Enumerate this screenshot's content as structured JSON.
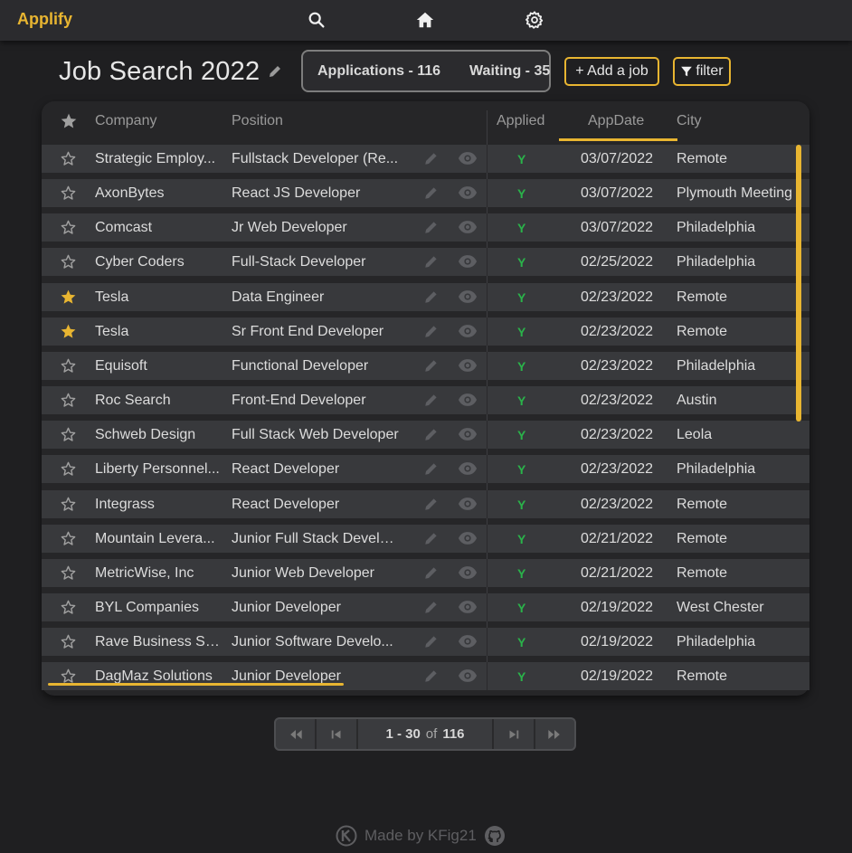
{
  "app": {
    "brand": "Applify"
  },
  "nav": {
    "icons": [
      "search-icon",
      "home-icon",
      "gear-icon"
    ]
  },
  "page": {
    "title": "Job Search 2022"
  },
  "stats": {
    "applications": "Applications - 116",
    "waiting": "Waiting - 35"
  },
  "actions": {
    "add_job": "+ Add a job",
    "filter": "filter"
  },
  "colors": {
    "accent": "#e8b531",
    "applied": "#2ab34a",
    "background": "#1f1f21",
    "row": "#38393c"
  },
  "table": {
    "columns": {
      "company": "Company",
      "position": "Position",
      "applied": "Applied",
      "appdate": "AppDate",
      "city": "City"
    },
    "sorted_column": "AppDate",
    "rows": [
      {
        "starred": false,
        "company": "Strategic Employ...",
        "position": "Fullstack Developer (Re...",
        "applied": "Y",
        "date": "03/07/2022",
        "city": "Remote"
      },
      {
        "starred": false,
        "company": "AxonBytes",
        "position": "React JS Developer",
        "applied": "Y",
        "date": "03/07/2022",
        "city": "Plymouth Meeting"
      },
      {
        "starred": false,
        "company": "Comcast",
        "position": "Jr Web Developer",
        "applied": "Y",
        "date": "03/07/2022",
        "city": "Philadelphia"
      },
      {
        "starred": false,
        "company": "Cyber Coders",
        "position": "Full-Stack Developer",
        "applied": "Y",
        "date": "02/25/2022",
        "city": "Philadelphia"
      },
      {
        "starred": true,
        "company": "Tesla",
        "position": "Data Engineer",
        "applied": "Y",
        "date": "02/23/2022",
        "city": "Remote"
      },
      {
        "starred": true,
        "company": "Tesla",
        "position": "Sr Front End Developer",
        "applied": "Y",
        "date": "02/23/2022",
        "city": "Remote"
      },
      {
        "starred": false,
        "company": "Equisoft",
        "position": "Functional Developer",
        "applied": "Y",
        "date": "02/23/2022",
        "city": "Philadelphia"
      },
      {
        "starred": false,
        "company": "Roc Search",
        "position": "Front-End Developer",
        "applied": "Y",
        "date": "02/23/2022",
        "city": "Austin"
      },
      {
        "starred": false,
        "company": "Schweb Design",
        "position": "Full Stack Web Developer",
        "applied": "Y",
        "date": "02/23/2022",
        "city": "Leola"
      },
      {
        "starred": false,
        "company": "Liberty Personnel...",
        "position": "React Developer",
        "applied": "Y",
        "date": "02/23/2022",
        "city": "Philadelphia"
      },
      {
        "starred": false,
        "company": "Integrass",
        "position": "React Developer",
        "applied": "Y",
        "date": "02/23/2022",
        "city": "Remote"
      },
      {
        "starred": false,
        "company": "Mountain Levera...",
        "position": "Junior Full Stack Develo...",
        "applied": "Y",
        "date": "02/21/2022",
        "city": "Remote"
      },
      {
        "starred": false,
        "company": "MetricWise, Inc",
        "position": "Junior Web Developer",
        "applied": "Y",
        "date": "02/21/2022",
        "city": "Remote"
      },
      {
        "starred": false,
        "company": "BYL Companies",
        "position": "Junior Developer",
        "applied": "Y",
        "date": "02/19/2022",
        "city": "West Chester"
      },
      {
        "starred": false,
        "company": "Rave Business Sy...",
        "position": "Junior Software Develo...",
        "applied": "Y",
        "date": "02/19/2022",
        "city": "Philadelphia"
      },
      {
        "starred": false,
        "company": "DagMaz Solutions",
        "position": "Junior Developer",
        "applied": "Y",
        "date": "02/19/2022",
        "city": "Remote"
      }
    ]
  },
  "pagination": {
    "range": "1 - 30",
    "of": "of",
    "total": "116"
  },
  "footer": {
    "text": "Made by KFig21"
  }
}
